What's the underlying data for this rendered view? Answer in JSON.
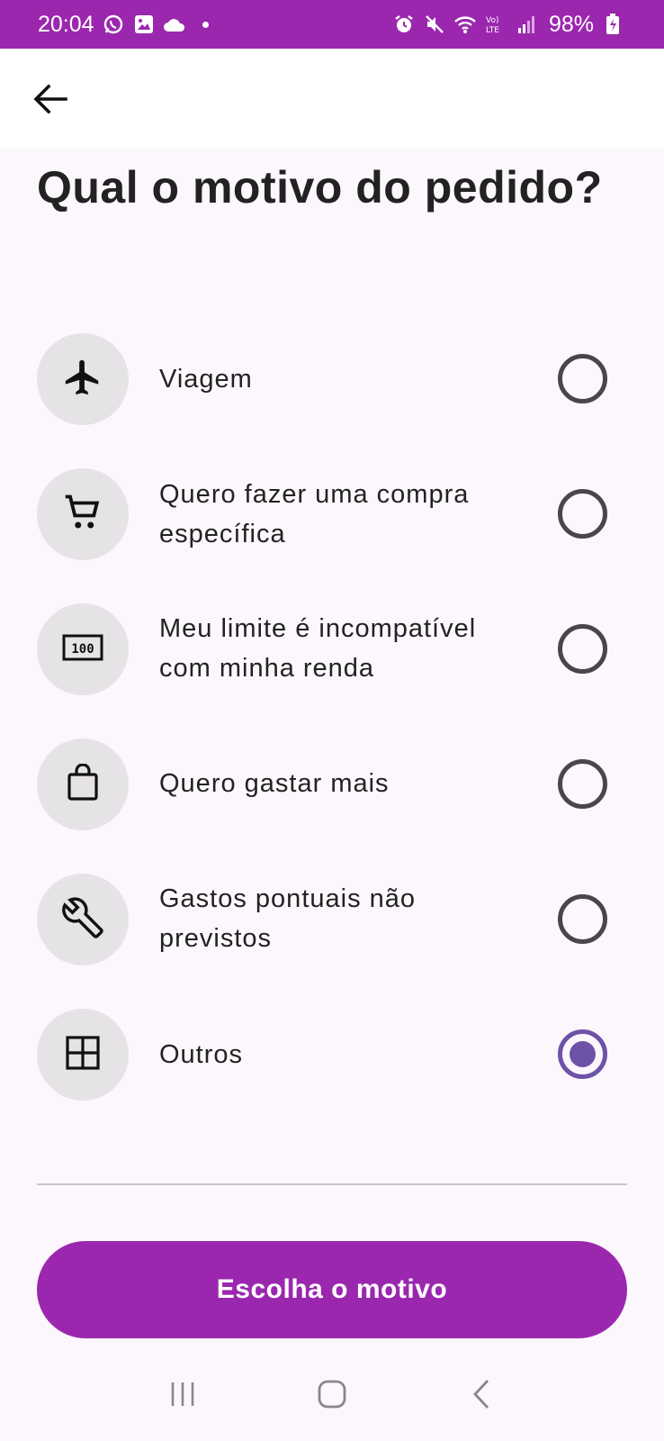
{
  "status_bar": {
    "time": "20:04",
    "battery": "98%",
    "icons": [
      "whatsapp-icon",
      "gallery-icon",
      "cloud-icon",
      "alarm-icon",
      "mute-icon",
      "wifi-icon",
      "volte-icon",
      "signal-icon",
      "battery-charging-icon"
    ]
  },
  "header": {
    "back_icon": "arrow-left-icon"
  },
  "page": {
    "title": "Qual o motivo do pedido?"
  },
  "options": [
    {
      "label": "Viagem",
      "icon": "airplane-icon",
      "selected": false
    },
    {
      "label": "Quero fazer uma compra específica",
      "icon": "shopping-cart-icon",
      "selected": false
    },
    {
      "label": "Meu limite é incompatível com minha renda",
      "icon": "money-100-icon",
      "selected": false
    },
    {
      "label": "Quero gastar mais",
      "icon": "shopping-bag-icon",
      "selected": false
    },
    {
      "label": "Gastos pontuais não previstos",
      "icon": "wrench-icon",
      "selected": false
    },
    {
      "label": "Outros",
      "icon": "grid-icon",
      "selected": true
    }
  ],
  "footer": {
    "button_label": "Escolha o motivo"
  },
  "colors": {
    "primary": "#9B27AF",
    "radio_selected": "#6E52A8",
    "radio_unselected": "#49454F",
    "icon_bg": "#E6E3E6",
    "page_bg": "#FCF7FC"
  },
  "nav": {
    "icons": [
      "recents-icon",
      "home-icon",
      "back-icon"
    ]
  }
}
